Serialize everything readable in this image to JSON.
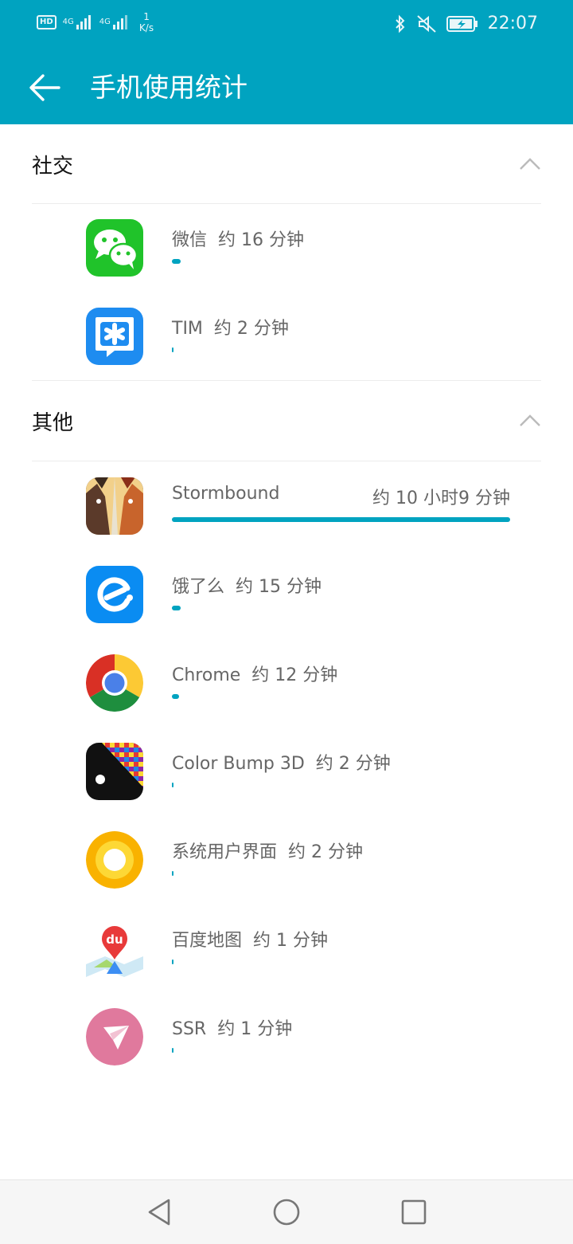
{
  "status_bar": {
    "hd": "HD",
    "net1": "4G",
    "net2": "4G",
    "speed_value": "1",
    "speed_unit": "K/s",
    "time": "22:07"
  },
  "toolbar": {
    "title": "手机使用统计"
  },
  "sections": {
    "social": {
      "title": "社交",
      "apps": [
        {
          "name": "微信",
          "time": "约 16 分钟",
          "usage_fraction": 0.026
        },
        {
          "name": "TIM",
          "time": "约 2 分钟",
          "usage_fraction": 0.004
        }
      ]
    },
    "other": {
      "title": "其他",
      "apps": [
        {
          "name": "Stormbound",
          "time": "约 10 小时9 分钟",
          "usage_fraction": 1.0
        },
        {
          "name": "饿了么",
          "time": "约 15 分钟",
          "usage_fraction": 0.025
        },
        {
          "name": "Chrome",
          "time": "约 12 分钟",
          "usage_fraction": 0.02
        },
        {
          "name": "Color Bump 3D",
          "time": "约 2 分钟",
          "usage_fraction": 0.004
        },
        {
          "name": "系统用户界面",
          "time": "约 2 分钟",
          "usage_fraction": 0.004
        },
        {
          "name": "百度地图",
          "time": "约 1 分钟",
          "usage_fraction": 0.002
        },
        {
          "name": "SSR",
          "time": "约 1 分钟",
          "usage_fraction": 0.002
        }
      ]
    }
  },
  "icons": {
    "baidu_label": "du"
  },
  "colors": {
    "accent": "#00a3c0"
  }
}
